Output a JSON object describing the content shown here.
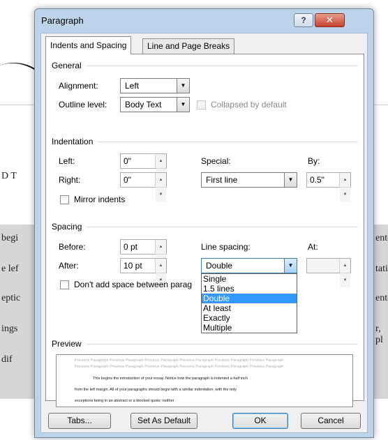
{
  "background_doc": {
    "fragment_top_left": "D T",
    "fragment_1": "begi",
    "fragment_2": "e lef",
    "fragment_3": "eptic",
    "fragment_4": "ings",
    "fragment_5": "dif",
    "fragment_right_1": "ente",
    "fragment_right_2": "tati",
    "fragment_right_3": "ente",
    "fragment_right_4": "r, pl"
  },
  "dialog": {
    "title": "Paragraph",
    "help_glyph": "?",
    "close_glyph": "✕"
  },
  "tabs": [
    {
      "label": "Indents and Spacing",
      "active": true
    },
    {
      "label": "Line and Page Breaks",
      "active": false
    }
  ],
  "general": {
    "heading": "General",
    "alignment_label": "Alignment:",
    "alignment_value": "Left",
    "outline_label": "Outline level:",
    "outline_value": "Body Text",
    "collapsed_label": "Collapsed by default"
  },
  "indentation": {
    "heading": "Indentation",
    "left_label": "Left:",
    "left_value": "0\"",
    "right_label": "Right:",
    "right_value": "0\"",
    "special_label": "Special:",
    "special_value": "First line",
    "by_label": "By:",
    "by_value": "0.5\"",
    "mirror_label": "Mirror indents"
  },
  "spacing": {
    "heading": "Spacing",
    "before_label": "Before:",
    "before_value": "0 pt",
    "after_label": "After:",
    "after_value": "10 pt",
    "line_spacing_label": "Line spacing:",
    "line_spacing_value": "Double",
    "at_label": "At:",
    "at_value": "",
    "dont_add_label": "Don't add space between parag",
    "line_spacing_options": [
      "Single",
      "1.5 lines",
      "Double",
      "At least",
      "Exactly",
      "Multiple"
    ],
    "selected_option": "Double"
  },
  "preview": {
    "heading": "Preview",
    "prev_line_1": "Previous Paragraph Previous Paragraph Previous Paragraph Previous Paragraph Previous Paragraph Previous Paragraph",
    "prev_line_2": "Previous Paragraph Previous Paragraph Previous Paragraph Previous Paragraph Previous Paragraph Previous Paragraph",
    "body_line_1": "This begins the introduction of your essay.  Notice how the paragraph is indented a half inch",
    "body_line_2": "from the left margin.  All of your paragraphs should begin with a similar indentation, with the only",
    "body_line_3": "exceptions being in an abstract or a blocked quote; neither"
  },
  "buttons": {
    "tabs": "Tabs...",
    "set_default": "Set As Default",
    "ok": "OK",
    "cancel": "Cancel"
  }
}
